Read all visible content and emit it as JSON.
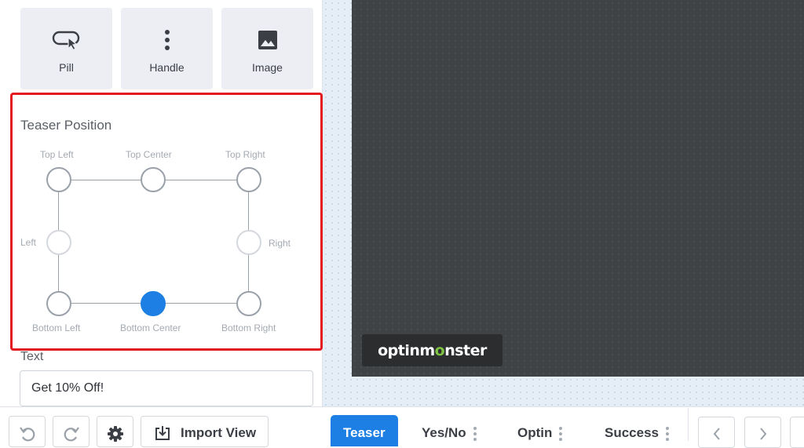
{
  "style_options": [
    {
      "label": "Pill",
      "icon": "pill-cursor-icon"
    },
    {
      "label": "Handle",
      "icon": "vertical-dots-icon"
    },
    {
      "label": "Image",
      "icon": "image-icon"
    }
  ],
  "teaser_position": {
    "title": "Teaser Position",
    "positions": {
      "top_left": "Top Left",
      "top_center": "Top Center",
      "top_right": "Top Right",
      "left": "Left",
      "right": "Right",
      "bottom_left": "Bottom Left",
      "bottom_center": "Bottom Center",
      "bottom_right": "Bottom Right"
    },
    "selected": "Bottom Center"
  },
  "text_field": {
    "label": "Text",
    "value": "Get 10% Off!"
  },
  "toolbar": {
    "undo_icon": "undo-icon",
    "redo_icon": "redo-icon",
    "settings_icon": "gear-icon",
    "import_label": "Import View"
  },
  "preview": {
    "logo_prefix": "optinm",
    "logo_monster": "o",
    "logo_suffix": "nster"
  },
  "views": {
    "tabs": [
      {
        "label": "Teaser",
        "active": true
      },
      {
        "label": "Yes/No",
        "active": false
      },
      {
        "label": "Optin",
        "active": false
      },
      {
        "label": "Success",
        "active": false
      }
    ]
  },
  "colors": {
    "accent": "#1d7fe3",
    "highlight": "#e4181f",
    "preview_bg": "#404346",
    "brand_green": "#7ec242"
  }
}
